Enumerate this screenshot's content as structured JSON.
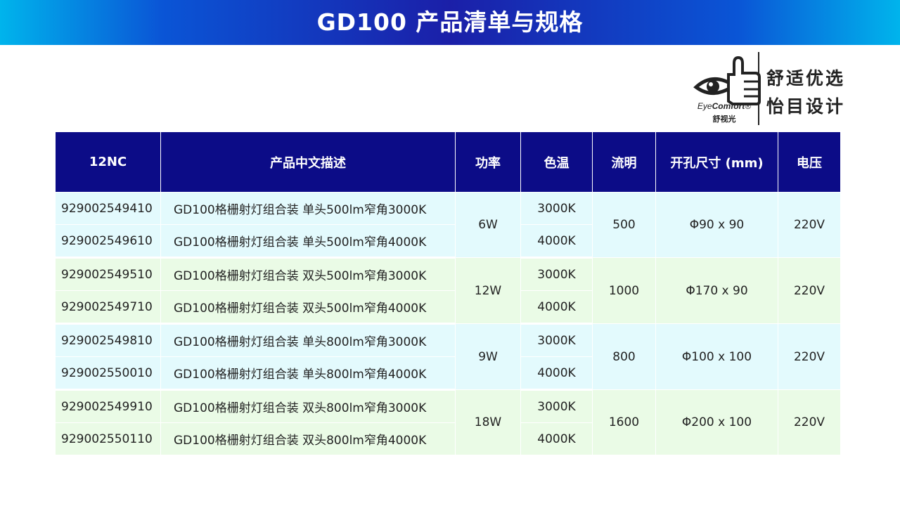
{
  "banner": {
    "title": "GD100 产品清单与规格"
  },
  "logo": {
    "brand_eye": "Eye",
    "brand_comfort": "Comfort",
    "brand_mark": "®",
    "brand_cn": "舒视光",
    "slogan_line1": "舒适优选",
    "slogan_line2": "怡目设计",
    "icon": "eye-thumbs-up-icon"
  },
  "colors": {
    "header_bg": "#0c0c87",
    "row_group_a": "#e3fafd",
    "row_group_b": "#eafbe6",
    "banner_center": "#1b1fa8",
    "banner_edge": "#00b4ec"
  },
  "table": {
    "headers": [
      "12NC",
      "产品中文描述",
      "功率",
      "色温",
      "流明",
      "开孔尺寸 (mm)",
      "电压"
    ],
    "groups": [
      {
        "power": "6W",
        "lumen": "500",
        "cutout": "Φ90 x 90",
        "voltage": "220V",
        "rows": [
          {
            "nc": "929002549410",
            "desc": "GD100格栅射灯组合装 单头500lm窄角3000K",
            "cct": "3000K"
          },
          {
            "nc": "929002549610",
            "desc": "GD100格栅射灯组合装 单头500lm窄角4000K",
            "cct": "4000K"
          }
        ]
      },
      {
        "power": "12W",
        "lumen": "1000",
        "cutout": "Φ170 x 90",
        "voltage": "220V",
        "rows": [
          {
            "nc": "929002549510",
            "desc": "GD100格栅射灯组合装 双头500lm窄角3000K",
            "cct": "3000K"
          },
          {
            "nc": "929002549710",
            "desc": "GD100格栅射灯组合装 双头500lm窄角4000K",
            "cct": "4000K"
          }
        ]
      },
      {
        "power": "9W",
        "lumen": "800",
        "cutout": "Φ100 x 100",
        "voltage": "220V",
        "rows": [
          {
            "nc": "929002549810",
            "desc": "GD100格栅射灯组合装 单头800lm窄角3000K",
            "cct": "3000K"
          },
          {
            "nc": "929002550010",
            "desc": "GD100格栅射灯组合装 单头800lm窄角4000K",
            "cct": "4000K"
          }
        ]
      },
      {
        "power": "18W",
        "lumen": "1600",
        "cutout": "Φ200 x 100",
        "voltage": "220V",
        "rows": [
          {
            "nc": "929002549910",
            "desc": "GD100格栅射灯组合装 双头800lm窄角3000K",
            "cct": "3000K"
          },
          {
            "nc": "929002550110",
            "desc": "GD100格栅射灯组合装 双头800lm窄角4000K",
            "cct": "4000K"
          }
        ]
      }
    ]
  }
}
